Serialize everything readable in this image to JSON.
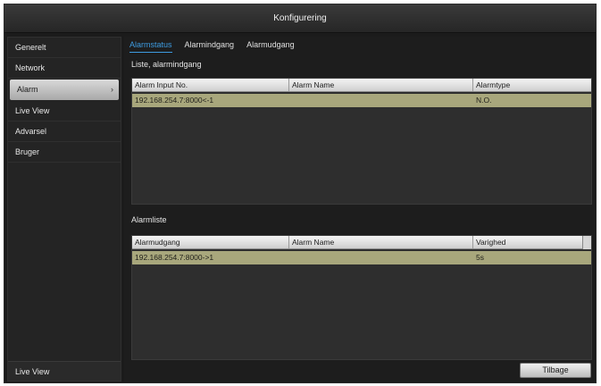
{
  "window": {
    "title": "Konfigurering"
  },
  "sidebar": {
    "items": [
      {
        "label": "Generelt",
        "active": false
      },
      {
        "label": "Network",
        "active": false
      },
      {
        "label": "Alarm",
        "active": true
      },
      {
        "label": "Live View",
        "active": false
      },
      {
        "label": "Advarsel",
        "active": false
      },
      {
        "label": "Bruger",
        "active": false
      }
    ],
    "bottom_label": "Live View"
  },
  "tabs": [
    {
      "label": "Alarmstatus",
      "active": true
    },
    {
      "label": "Alarmindgang",
      "active": false
    },
    {
      "label": "Alarmudgang",
      "active": false
    }
  ],
  "input_section": {
    "title": "Liste, alarmindgang",
    "columns": [
      "Alarm Input No.",
      "Alarm Name",
      "Alarmtype"
    ],
    "rows": [
      [
        "192.168.254.7:8000<-1",
        "",
        "N.O."
      ]
    ]
  },
  "output_section": {
    "title": "Alarmliste",
    "columns": [
      "Alarmudgang",
      "Alarm Name",
      "Varighed"
    ],
    "rows": [
      [
        "192.168.254.7:8000->1",
        "",
        "5s"
      ]
    ]
  },
  "footer": {
    "back_label": "Tilbage"
  }
}
